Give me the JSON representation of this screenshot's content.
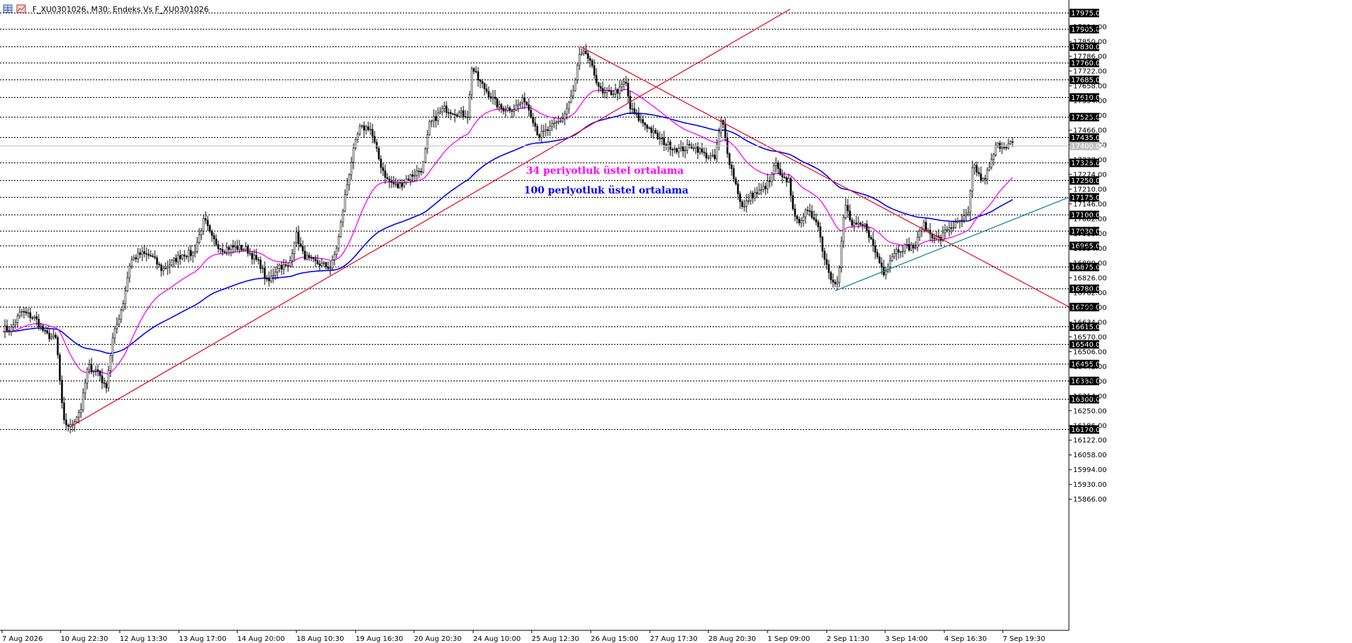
{
  "window": {
    "title": "F_XU0301026, M30:  Endeks Vs F_XU0301026"
  },
  "colors": {
    "background": "#ffffff",
    "bull_body": "#ffffff",
    "bear_body": "#000000",
    "candle_outline": "#000000",
    "ema34": "#ff00ff",
    "ema100": "#0000ff",
    "trendline_red": "#e8112d",
    "trendline_teal": "#1a8a8a",
    "level_label_bg": "#000000",
    "current_price_line": "#c0c0c0"
  },
  "annotations": [
    {
      "name": "ema34-label",
      "text": "34 periyotluk üstel ortalama",
      "color": "#ff00ff"
    },
    {
      "name": "ema100-label",
      "text": "100 periyotluk üstel ortalama",
      "color": "#0000ff"
    }
  ],
  "chart_data": {
    "type": "candlestick",
    "symbol": "F_XU0301026",
    "timeframe": "M30",
    "ylim": [
      15800,
      18010
    ],
    "x_tick_labels": [
      "7 Aug 2026",
      "10 Aug 22:30",
      "12 Aug 13:30",
      "13 Aug 17:00",
      "14 Aug 20:00",
      "18 Aug 10:30",
      "19 Aug 16:30",
      "20 Aug 20:30",
      "24 Aug 10:00",
      "25 Aug 12:30",
      "26 Aug 15:00",
      "27 Aug 17:30",
      "28 Aug 20:30",
      "1 Sep 09:00",
      "2 Sep 11:30",
      "3 Sep 14:00",
      "4 Sep 16:30",
      "7 Sep 19:30"
    ],
    "y_tick_labels": [
      17914,
      17850,
      17786,
      17722,
      17658,
      17594,
      17530,
      17466,
      17402,
      17338,
      17274,
      17210,
      17146,
      17082,
      17018,
      16954,
      16890,
      16826,
      16762,
      16698,
      16634,
      16570,
      16506,
      16442,
      16378,
      16314,
      16250,
      16186,
      16122,
      16058,
      15994,
      15930,
      15866
    ],
    "horizontal_levels": [
      17975,
      17905,
      17830,
      17760,
      17685,
      17610,
      17525,
      17435,
      17325,
      17250,
      17175,
      17100,
      17030,
      16965,
      16875,
      16780,
      16700,
      16615,
      16540,
      16455,
      16380,
      16300,
      16170
    ],
    "current_price": 17400,
    "price_anchors": [
      [
        0,
        16610
      ],
      [
        15,
        16600
      ],
      [
        30,
        16680
      ],
      [
        50,
        16650
      ],
      [
        65,
        16580
      ],
      [
        80,
        16560
      ],
      [
        90,
        16200
      ],
      [
        100,
        16180
      ],
      [
        115,
        16260
      ],
      [
        125,
        16440
      ],
      [
        140,
        16420
      ],
      [
        150,
        16340
      ],
      [
        160,
        16560
      ],
      [
        175,
        16720
      ],
      [
        185,
        16900
      ],
      [
        200,
        16930
      ],
      [
        215,
        16920
      ],
      [
        230,
        16860
      ],
      [
        260,
        16930
      ],
      [
        275,
        16930
      ],
      [
        290,
        17080
      ],
      [
        300,
        17000
      ],
      [
        315,
        16950
      ],
      [
        330,
        16960
      ],
      [
        350,
        16950
      ],
      [
        370,
        16880
      ],
      [
        380,
        16800
      ],
      [
        395,
        16880
      ],
      [
        410,
        16870
      ],
      [
        420,
        17020
      ],
      [
        430,
        16930
      ],
      [
        440,
        16900
      ],
      [
        460,
        16880
      ],
      [
        470,
        16870
      ],
      [
        480,
        16980
      ],
      [
        490,
        17180
      ],
      [
        500,
        17350
      ],
      [
        510,
        17470
      ],
      [
        525,
        17480
      ],
      [
        540,
        17320
      ],
      [
        550,
        17250
      ],
      [
        565,
        17220
      ],
      [
        580,
        17260
      ],
      [
        600,
        17300
      ],
      [
        610,
        17490
      ],
      [
        630,
        17560
      ],
      [
        650,
        17540
      ],
      [
        665,
        17530
      ],
      [
        670,
        17740
      ],
      [
        680,
        17680
      ],
      [
        695,
        17620
      ],
      [
        710,
        17560
      ],
      [
        730,
        17560
      ],
      [
        745,
        17600
      ],
      [
        755,
        17530
      ],
      [
        765,
        17440
      ],
      [
        780,
        17470
      ],
      [
        800,
        17520
      ],
      [
        815,
        17640
      ],
      [
        822,
        17780
      ],
      [
        832,
        17800
      ],
      [
        845,
        17700
      ],
      [
        855,
        17620
      ],
      [
        870,
        17630
      ],
      [
        880,
        17640
      ],
      [
        888,
        17680
      ],
      [
        895,
        17560
      ],
      [
        905,
        17520
      ],
      [
        920,
        17480
      ],
      [
        935,
        17430
      ],
      [
        950,
        17400
      ],
      [
        965,
        17380
      ],
      [
        985,
        17400
      ],
      [
        1000,
        17360
      ],
      [
        1015,
        17340
      ],
      [
        1025,
        17520
      ],
      [
        1035,
        17340
      ],
      [
        1045,
        17230
      ],
      [
        1055,
        17120
      ],
      [
        1065,
        17180
      ],
      [
        1080,
        17200
      ],
      [
        1095,
        17250
      ],
      [
        1100,
        17330
      ],
      [
        1110,
        17250
      ],
      [
        1120,
        17250
      ],
      [
        1130,
        17060
      ],
      [
        1145,
        17110
      ],
      [
        1160,
        17080
      ],
      [
        1170,
        16920
      ],
      [
        1180,
        16830
      ],
      [
        1190,
        16800
      ],
      [
        1200,
        17150
      ],
      [
        1210,
        17050
      ],
      [
        1230,
        17050
      ],
      [
        1240,
        16960
      ],
      [
        1255,
        16850
      ],
      [
        1270,
        16940
      ],
      [
        1285,
        16960
      ],
      [
        1300,
        16960
      ],
      [
        1310,
        17060
      ],
      [
        1320,
        17020
      ],
      [
        1335,
        16990
      ],
      [
        1345,
        17040
      ],
      [
        1360,
        17060
      ],
      [
        1375,
        17100
      ],
      [
        1382,
        17320
      ],
      [
        1395,
        17240
      ],
      [
        1405,
        17300
      ],
      [
        1415,
        17400
      ],
      [
        1425,
        17400
      ],
      [
        1440,
        17410
      ]
    ],
    "ema34_label": "34 periyotluk üstel ortalama",
    "ema100_label": "100 periyotluk üstel ortalama",
    "trendlines": [
      {
        "name": "uptrend-red",
        "color": "#e8112d",
        "from": {
          "x_index": 100,
          "price": 16180
        },
        "to": {
          "x_index": 1122,
          "price": 17990
        }
      },
      {
        "name": "downtrend-red",
        "color": "#e8112d",
        "from": {
          "x_index": 823,
          "price": 17830
        },
        "to": {
          "x_index": 1518,
          "price": 16700
        }
      },
      {
        "name": "support-teal",
        "color": "#1a8a8a",
        "from": {
          "x_index": 1186,
          "price": 16770
        },
        "to": {
          "x_index": 1518,
          "price": 17175
        }
      }
    ],
    "grid": true,
    "legend": "none"
  }
}
